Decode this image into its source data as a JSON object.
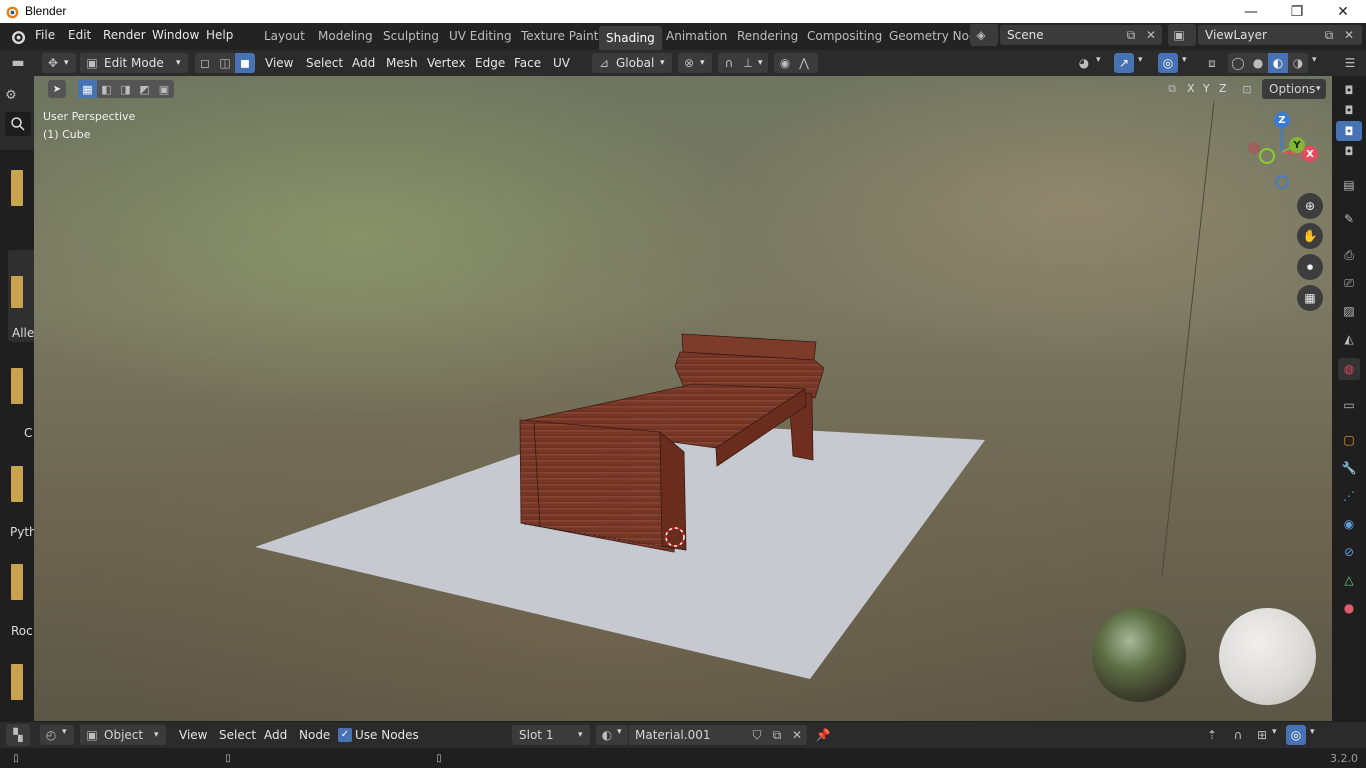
{
  "window": {
    "title": "Blender",
    "minimize": "—",
    "maximize": "❐",
    "close": "✕"
  },
  "menus": [
    "File",
    "Edit",
    "Render",
    "Window",
    "Help"
  ],
  "workspaces": [
    "Layout",
    "Modeling",
    "Sculpting",
    "UV Editing",
    "Texture Paint",
    "Shading",
    "Animation",
    "Rendering",
    "Compositing",
    "Geometry Noc"
  ],
  "active_workspace": "Shading",
  "scene": {
    "name": "Scene",
    "view_layer": "ViewLayer"
  },
  "header": {
    "mode": "Edit Mode",
    "menus": [
      "View",
      "Select",
      "Add",
      "Mesh",
      "Vertex",
      "Edge",
      "Face",
      "UV"
    ],
    "orientation": "Global"
  },
  "viewport": {
    "perspective_label": "User Perspective",
    "object_label": "(1) Cube",
    "options": "Options",
    "axes_toggle": [
      "X",
      "Y",
      "Z"
    ],
    "gizmo": {
      "z": "Z",
      "y": "Y",
      "x": "X"
    }
  },
  "left_tabs": [
    "Alle",
    "C",
    "Pyth",
    "Roc"
  ],
  "nodebar": {
    "editor": "Object",
    "menus": [
      "View",
      "Select",
      "Add",
      "Node"
    ],
    "use_nodes": "Use Nodes",
    "use_nodes_checked": true,
    "slot": "Slot 1",
    "material": "Material.001"
  },
  "status": {
    "version": "3.2.0"
  },
  "colors": {
    "accent": "#4772b3",
    "header": "#2b2b2b",
    "wood": "#7a3a28",
    "plane": "#c7c9d1"
  }
}
